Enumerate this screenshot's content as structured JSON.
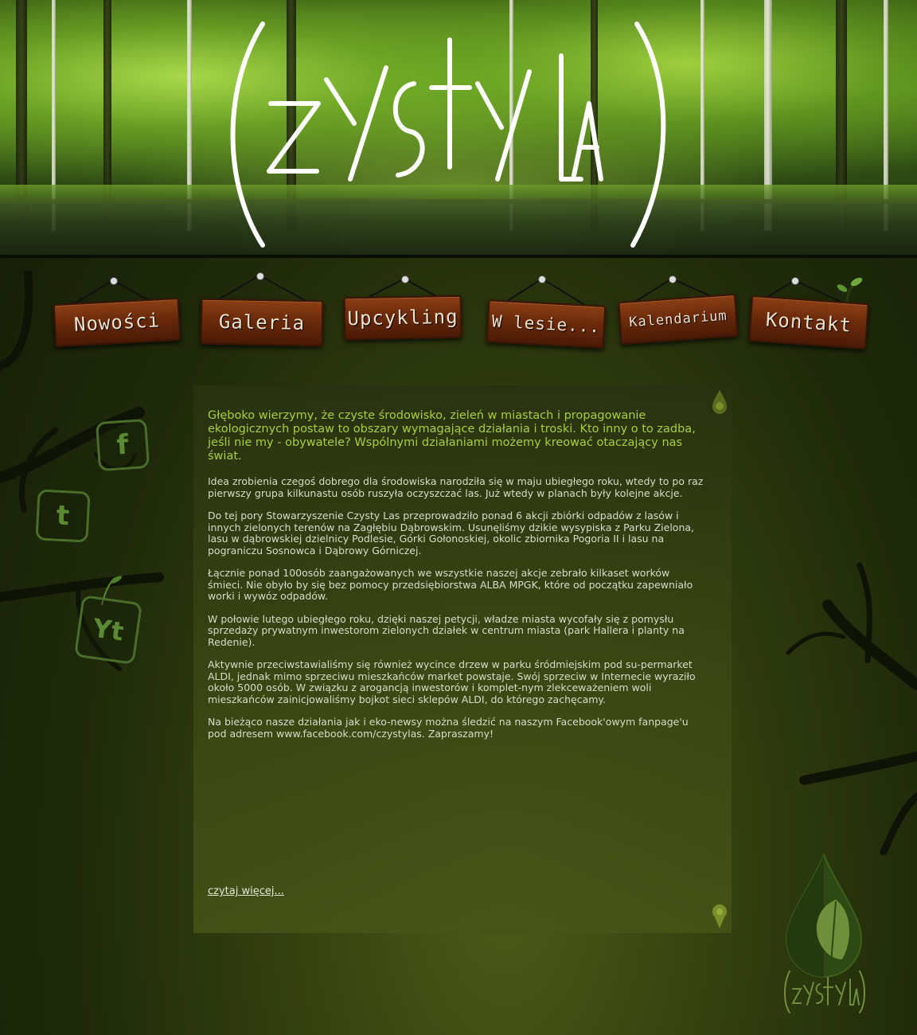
{
  "header": {
    "logo_alt": "Czysty Las"
  },
  "nav": {
    "items": [
      {
        "label": "Nowości"
      },
      {
        "label": "Galeria"
      },
      {
        "label": "Upcykling"
      },
      {
        "label": "W lesie..."
      },
      {
        "label": "Kalendarium"
      },
      {
        "label": "Kontakt"
      }
    ]
  },
  "social": {
    "facebook": "f",
    "twitter": "t",
    "youtube": "Yt"
  },
  "content": {
    "intro": "Głęboko wierzymy, że czyste środowisko, zieleń w miastach i propagowanie ekologicznych postaw to obszary wymagające działania i troski. Kto inny o to zadba, jeśli nie my - obywatele? Wspólnymi działaniami możemy kreować otaczający nas świat.",
    "paragraphs": [
      "Idea zrobienia czegoś dobrego dla środowiska narodziła się w maju ubiegłego roku, wtedy to po raz pierwszy grupa kilkunastu osób ruszyła oczyszczać las. Już wtedy w planach były kolejne akcje.",
      "Do tej pory Stowarzyszenie Czysty Las przeprowadziło ponad 6 akcji zbiórki odpadów z lasów i innych zielonych terenów na Zagłębiu Dąbrowskim. Usunęliśmy dzikie wysypiska z Parku Zielona, lasu w dąbrowskiej dzielnicy Podlesie, Górki Gołonoskiej, okolic zbiornika Pogoria II i lasu na pograniczu Sosnowca i Dąbrowy Górniczej.",
      "Łącznie ponad 100osób zaangażowanych we wszystkie naszej akcje zebrało kilkaset worków śmieci. Nie obyło by się bez pomocy przedsiębiorstwa ALBA MPGK, które od początku zapewniało worki i wywóz odpadów.",
      "W połowie lutego ubiegłego roku, dzięki naszej petycji, władze miasta wycofały się z pomysłu sprzedaży prywatnym inwestorom zielonych działek w centrum miasta (park Hallera i planty na Redenie).",
      "Aktywnie przeciwstawialiśmy się również wycince drzew w parku śródmiejskim pod su-permarket ALDI, jednak mimo sprzeciwu mieszkańców market powstaje. Swój sprzeciw w Internecie wyraziło około 5000 osób. W związku z arogancją inwestorów i komplet-nym zlekceważeniem woli mieszkańców zainicjowaliśmy bojkot sieci sklepów ALDI, do którego zachęcamy.",
      "Na bieżąco nasze działania jak i eko-newsy można śledzić na naszym Facebook'owym fanpage'u pod adresem www.facebook.com/czystylas. Zapraszamy!"
    ],
    "read_more": "czytaj więcej..."
  },
  "colors": {
    "intro_text": "#a8cf3c",
    "body_text": "#d8dcc8",
    "sign_wood": "#6b2a0b",
    "background": "#1f2a0a"
  }
}
